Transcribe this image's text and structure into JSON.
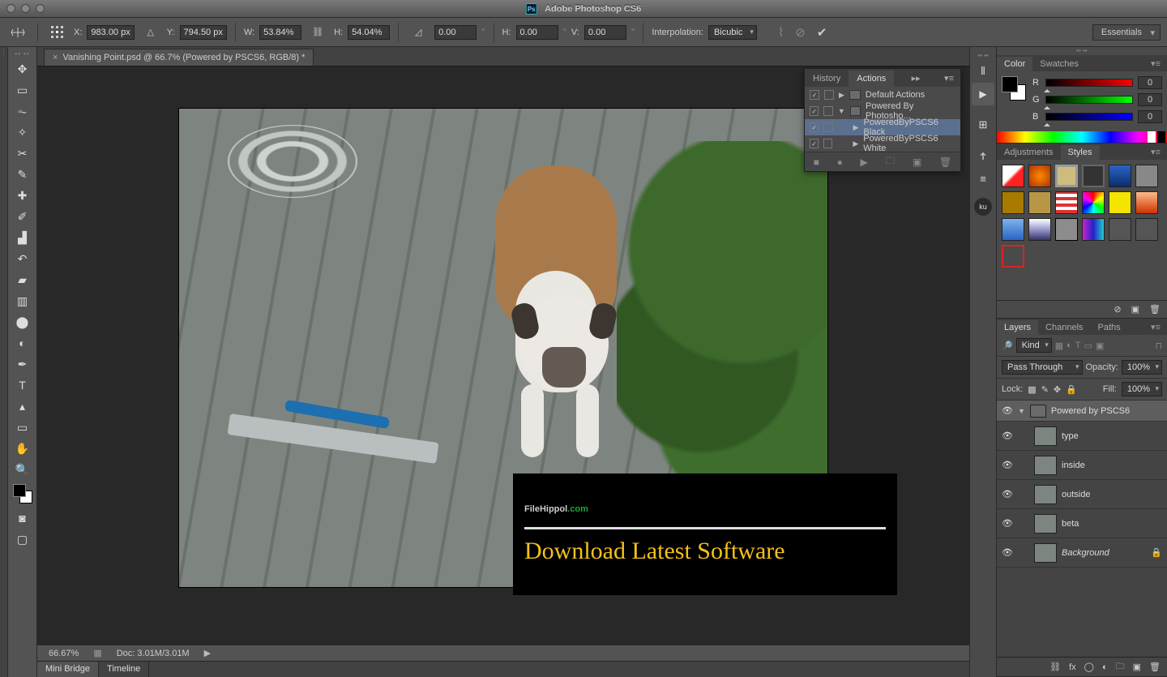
{
  "title": "Adobe Photoshop CS6",
  "options": {
    "x_label": "X:",
    "x": "983.00 px",
    "y_label": "Y:",
    "y": "794.50 px",
    "w_label": "W:",
    "w": "53.84%",
    "h_label": "H:",
    "h": "54.04%",
    "angle_label": "",
    "angle": "0.00",
    "hskew_label": "H:",
    "hskew": "0.00",
    "vskew_label": "V:",
    "vskew": "0.00",
    "interp_label": "Interpolation:",
    "interp": "Bicubic",
    "workspace": "Essentials"
  },
  "doc_tab": "Vanishing Point.psd @ 66.7% (Powered by PSCS6, RGB/8) *",
  "banner": {
    "l1a": "FileHippol",
    "l1b": ".com",
    "l2": "Download Latest Software"
  },
  "status": {
    "zoom": "66.67%",
    "doc": "Doc: 3.01M/3.01M"
  },
  "bottom_tabs": {
    "mini": "Mini Bridge",
    "timeline": "Timeline"
  },
  "actions": {
    "tab_history": "History",
    "tab_actions": "Actions",
    "rows": [
      {
        "name": "Default Actions",
        "kind": "folder",
        "sel": false,
        "indent": 0,
        "tri": "▶"
      },
      {
        "name": "Powered By Photosho...",
        "kind": "folder-open",
        "sel": false,
        "indent": 0,
        "tri": "▼"
      },
      {
        "name": "PoweredByPSCS6 Black",
        "kind": "item",
        "sel": true,
        "indent": 1,
        "tri": "▶"
      },
      {
        "name": "PoweredByPSCS6 White",
        "kind": "item",
        "sel": false,
        "indent": 1,
        "tri": "▶"
      }
    ]
  },
  "color": {
    "tab_color": "Color",
    "tab_swatches": "Swatches",
    "r": "R",
    "g": "G",
    "b": "B",
    "rv": "0",
    "gv": "0",
    "bv": "0"
  },
  "styles": {
    "tab_adj": "Adjustments",
    "tab_styles": "Styles"
  },
  "layers": {
    "tab_layers": "Layers",
    "tab_channels": "Channels",
    "tab_paths": "Paths",
    "kind": "Kind",
    "blend": "Pass Through",
    "opacity_l": "Opacity:",
    "opacity": "100%",
    "lock_l": "Lock:",
    "fill_l": "Fill:",
    "fill": "100%",
    "items": [
      {
        "name": "Powered by PSCS6",
        "type": "group"
      },
      {
        "name": "type",
        "type": "layer"
      },
      {
        "name": "inside",
        "type": "layer"
      },
      {
        "name": "outside",
        "type": "layer"
      },
      {
        "name": "beta",
        "type": "layer"
      },
      {
        "name": "Background",
        "type": "bg"
      }
    ]
  },
  "iconstrip": {
    "ku": "ku"
  }
}
